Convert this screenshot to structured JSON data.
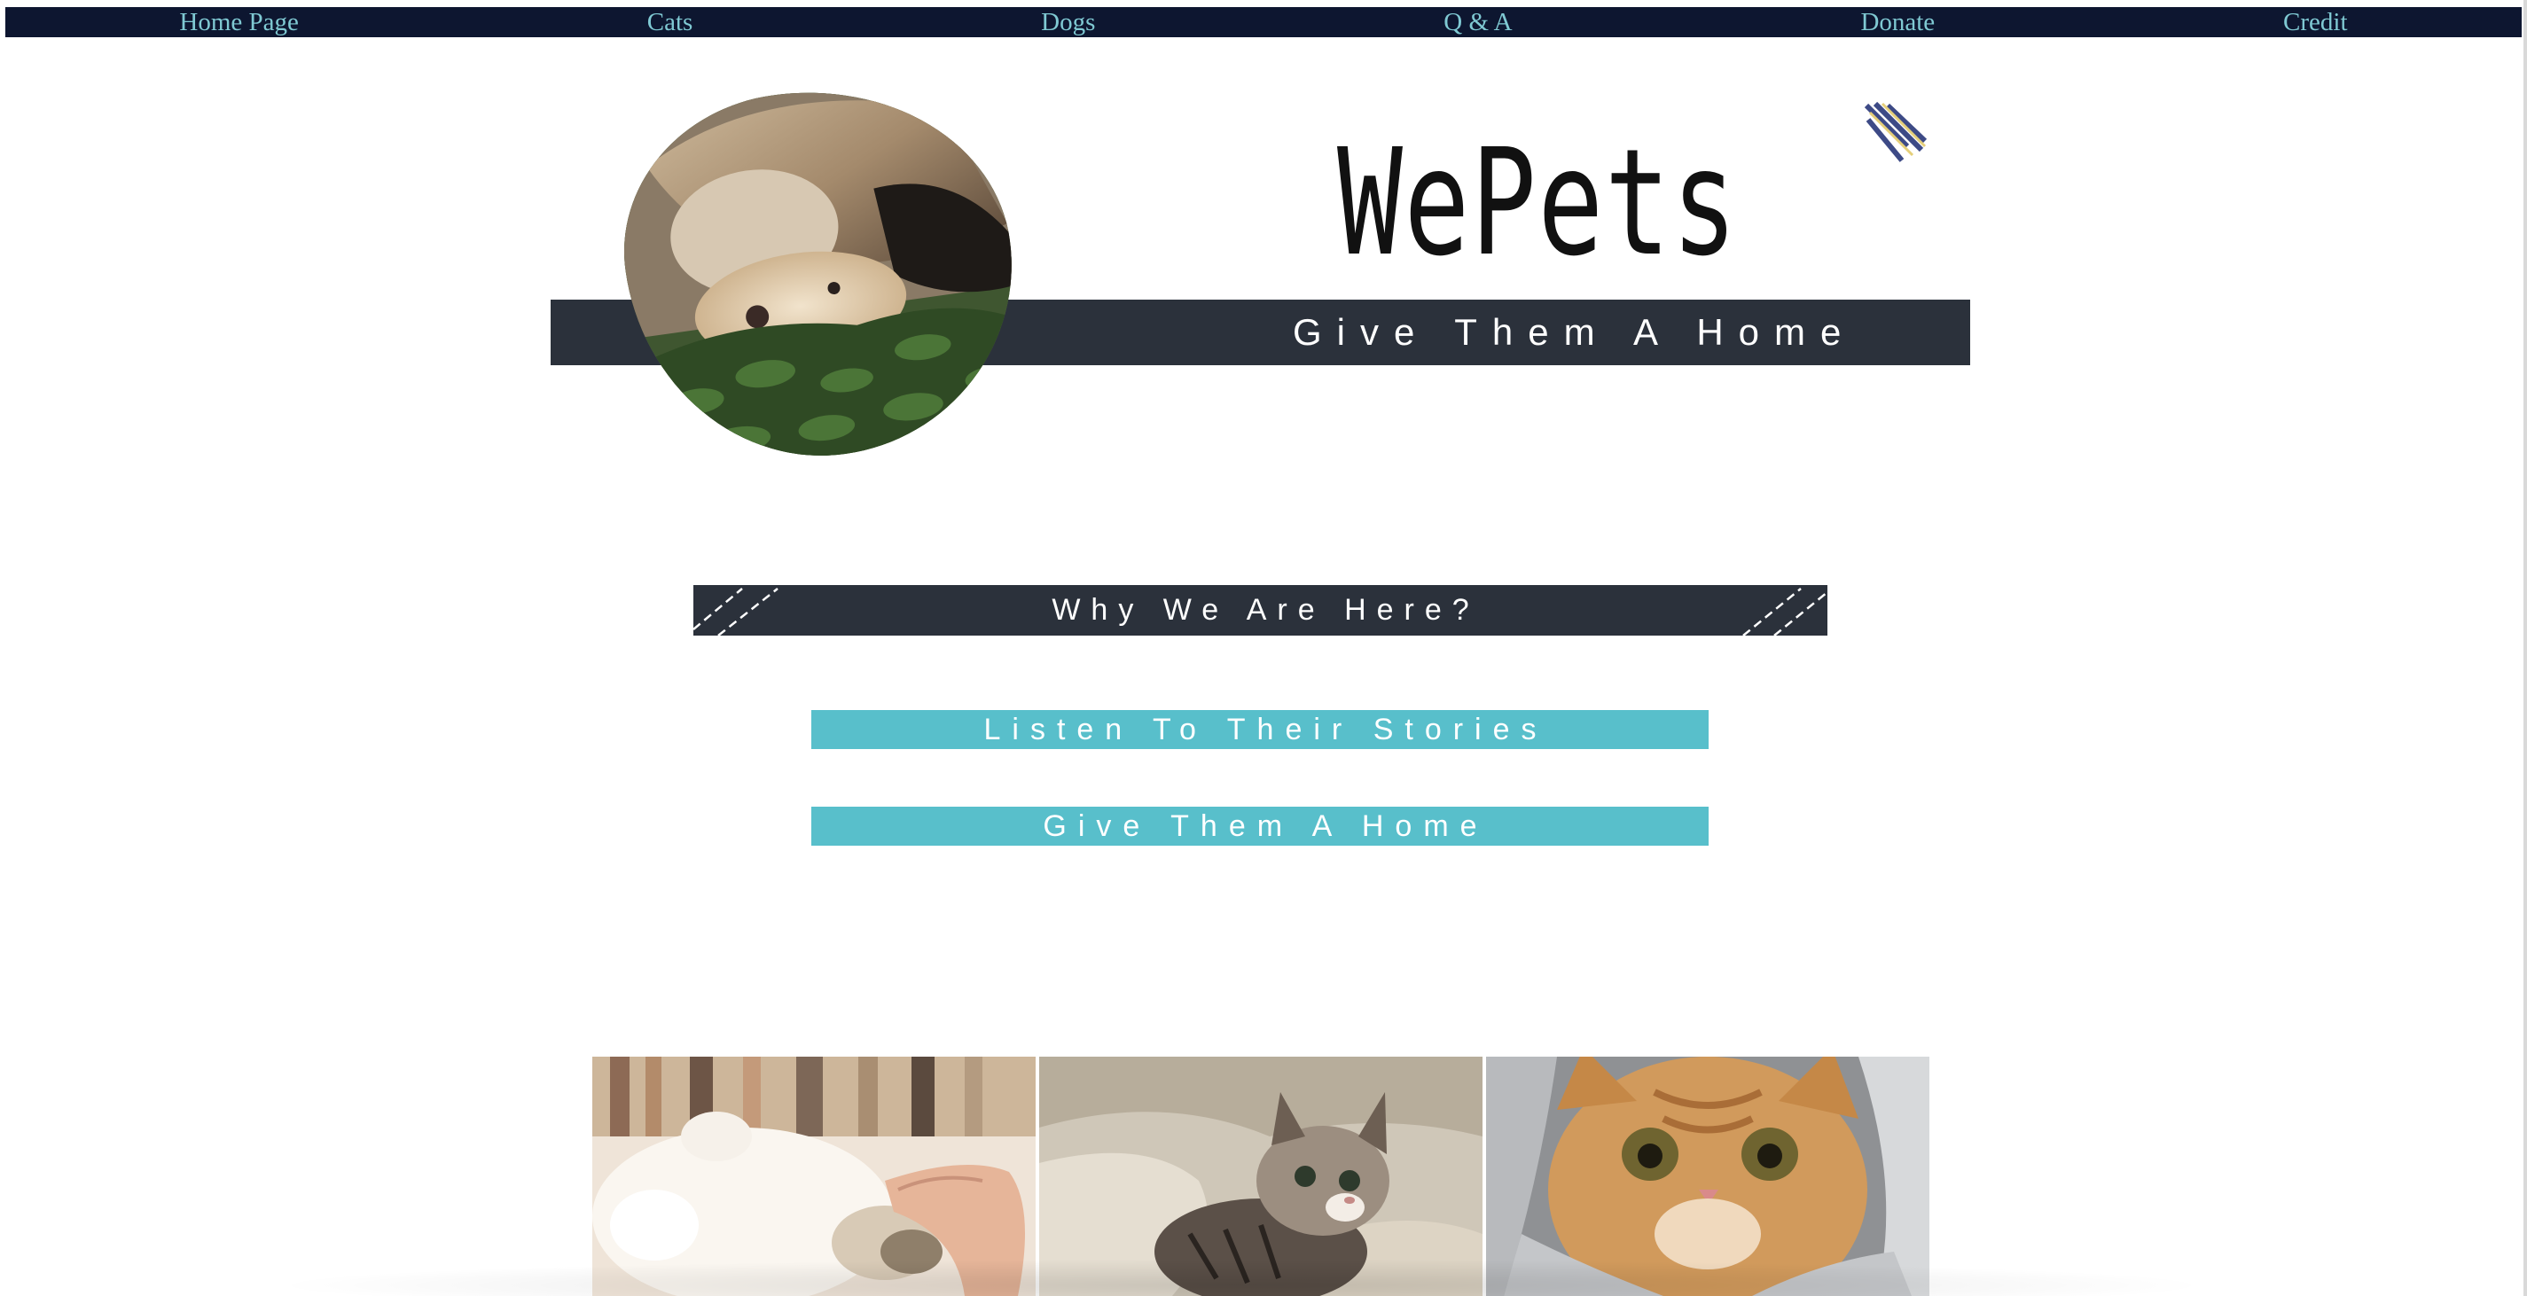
{
  "nav": {
    "items": [
      {
        "label": "Home Page"
      },
      {
        "label": "Cats"
      },
      {
        "label": "Dogs"
      },
      {
        "label": "Q & A"
      },
      {
        "label": "Donate"
      },
      {
        "label": "Credit"
      }
    ]
  },
  "hero": {
    "title": "WePets",
    "tagline": "Give Them A Home",
    "image": "cat-and-dog-cuddling-photo",
    "badge_icon": "striped-badge-icon"
  },
  "why": {
    "heading": "Why We Are Here?"
  },
  "actions": {
    "stories_label": "Listen To Their Stories",
    "home_label": "Give Them A Home"
  },
  "gallery": {
    "photos": [
      {
        "subject": "white-kitten-being-petted"
      },
      {
        "subject": "tabby-kitten-in-blanket"
      },
      {
        "subject": "orange-cat-closeup"
      }
    ]
  },
  "colors": {
    "nav_bg": "#0d1630",
    "nav_text": "#7fc9d3",
    "band": "#2b313b",
    "accent": "#58bfcb"
  }
}
